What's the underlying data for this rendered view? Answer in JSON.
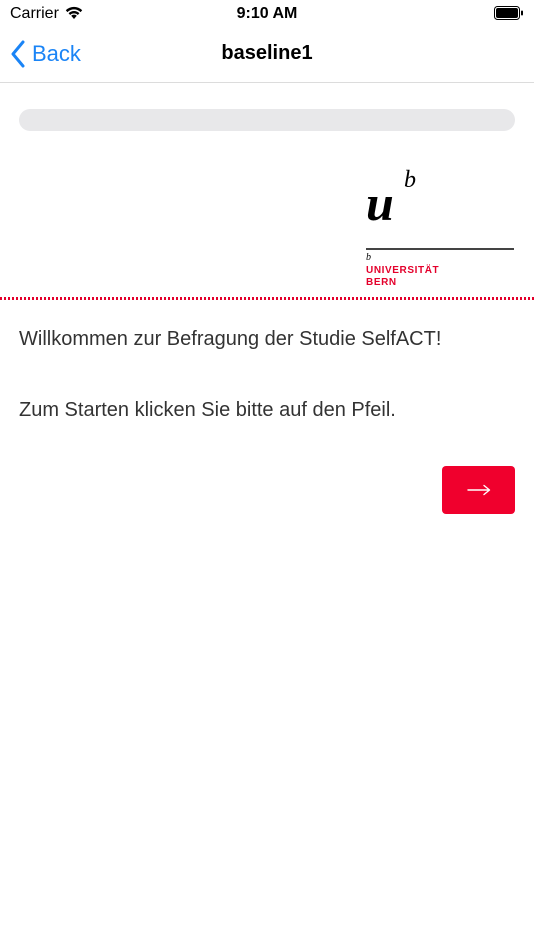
{
  "status_bar": {
    "carrier": "Carrier",
    "time": "9:10 AM",
    "icons": [
      "wifi-icon",
      "battery-icon"
    ]
  },
  "nav": {
    "back_label": "Back",
    "title": "baseline1",
    "back_icon": "chevron-left-icon",
    "accent_color": "#1a84f6"
  },
  "progress": {
    "fraction": 0.0
  },
  "logo": {
    "mark_u": "u",
    "mark_b": "b",
    "small_b": "b",
    "line1": "UNIVERSITÄT",
    "line2": "BERN",
    "brand_color": "#e4002b"
  },
  "content": {
    "welcome": "Willkommen zur Befragung der Studie SelfACT!",
    "instruction": "Zum Starten klicken Sie bitte auf den Pfeil."
  },
  "next_button": {
    "icon": "arrow-right-icon",
    "color": "#f0002d"
  }
}
